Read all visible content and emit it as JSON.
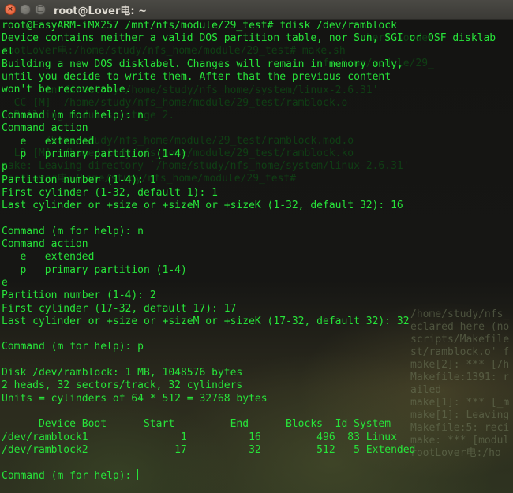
{
  "window": {
    "title": "root@Lover电: ~",
    "buttons": {
      "close": "×",
      "minimize": "–",
      "maximize": "□"
    }
  },
  "terminal": {
    "lines": [
      "root@EasyARM-iMX257 /mnt/nfs/module/29_test# fdisk /dev/ramblock",
      "Device contains neither a valid DOS partition table, nor Sun, SGI or OSF disklab",
      "el",
      "Building a new DOS disklabel. Changes will remain in memory only,",
      "until you decide to write them. After that the previous content",
      "won't be recoverable.",
      "",
      "Command (m for help): n",
      "Command action",
      "   e   extended",
      "   p   primary partition (1-4)",
      "p",
      "Partition number (1-4): 1",
      "First cylinder (1-32, default 1): 1",
      "Last cylinder or +size or +sizeM or +sizeK (1-32, default 32): 16",
      "",
      "Command (m for help): n",
      "Command action",
      "   e   extended",
      "   p   primary partition (1-4)",
      "e",
      "Partition number (1-4): 2",
      "First cylinder (17-32, default 17): 17",
      "Last cylinder or +size or +sizeM or +sizeK (17-32, default 32): 32",
      "",
      "Command (m for help): p",
      "",
      "Disk /dev/ramblock: 1 MB, 1048576 bytes",
      "2 heads, 32 sectors/track, 32 cylinders",
      "Units = cylinders of 64 * 512 = 32768 bytes",
      "",
      "      Device Boot      Start         End      Blocks  Id System",
      "/dev/ramblock1               1          16         496  83 Linux",
      "/dev/ramblock2              17          32         512   5 Extended",
      "",
      "Command (m for help): "
    ],
    "colors": {
      "text": "#27e43a",
      "background": "#151512",
      "titlebar": "#3f3e3a",
      "close_button": "#e95a2f"
    }
  },
  "background_terminal": {
    "lines": [
      "                                                         orkers -order",
      "rootLover电:/home/study/nfs_home/module/29_test# make.sh",
      "                                                   nfs_home/module/29_",
      "       in directory /home/study/nfs_home/system/linux-2.6.31'",
      "  CC [M]  /home/study/nfs_home/module/29_test/ramblock.o",
      "  Building modules, stage 2.",
      "",
      "       /home/study/nfs_home/module/29_test/ramblock.mod.o",
      "  LD [M]  /home/study/nfs_home/module/29_test/ramblock.ko",
      "make: Leaving directory `/home/study/nfs_home/system/linux-2.6.31'",
      "rootLover电:/home/study/nfs_home/module/29_test# "
    ],
    "right_lines": [
      "/home/study/nfs_",
      "eclared here (no",
      "scripts/Makefile",
      "st/ramblock.o' f",
      "make[2]: *** [/h",
      "Makefile:1391: r",
      "ailed",
      "make[1]: *** [_m",
      "make[1]: Leaving",
      "Makefile:5: reci",
      "make: *** [modul",
      "rootLover电:/ho"
    ]
  }
}
